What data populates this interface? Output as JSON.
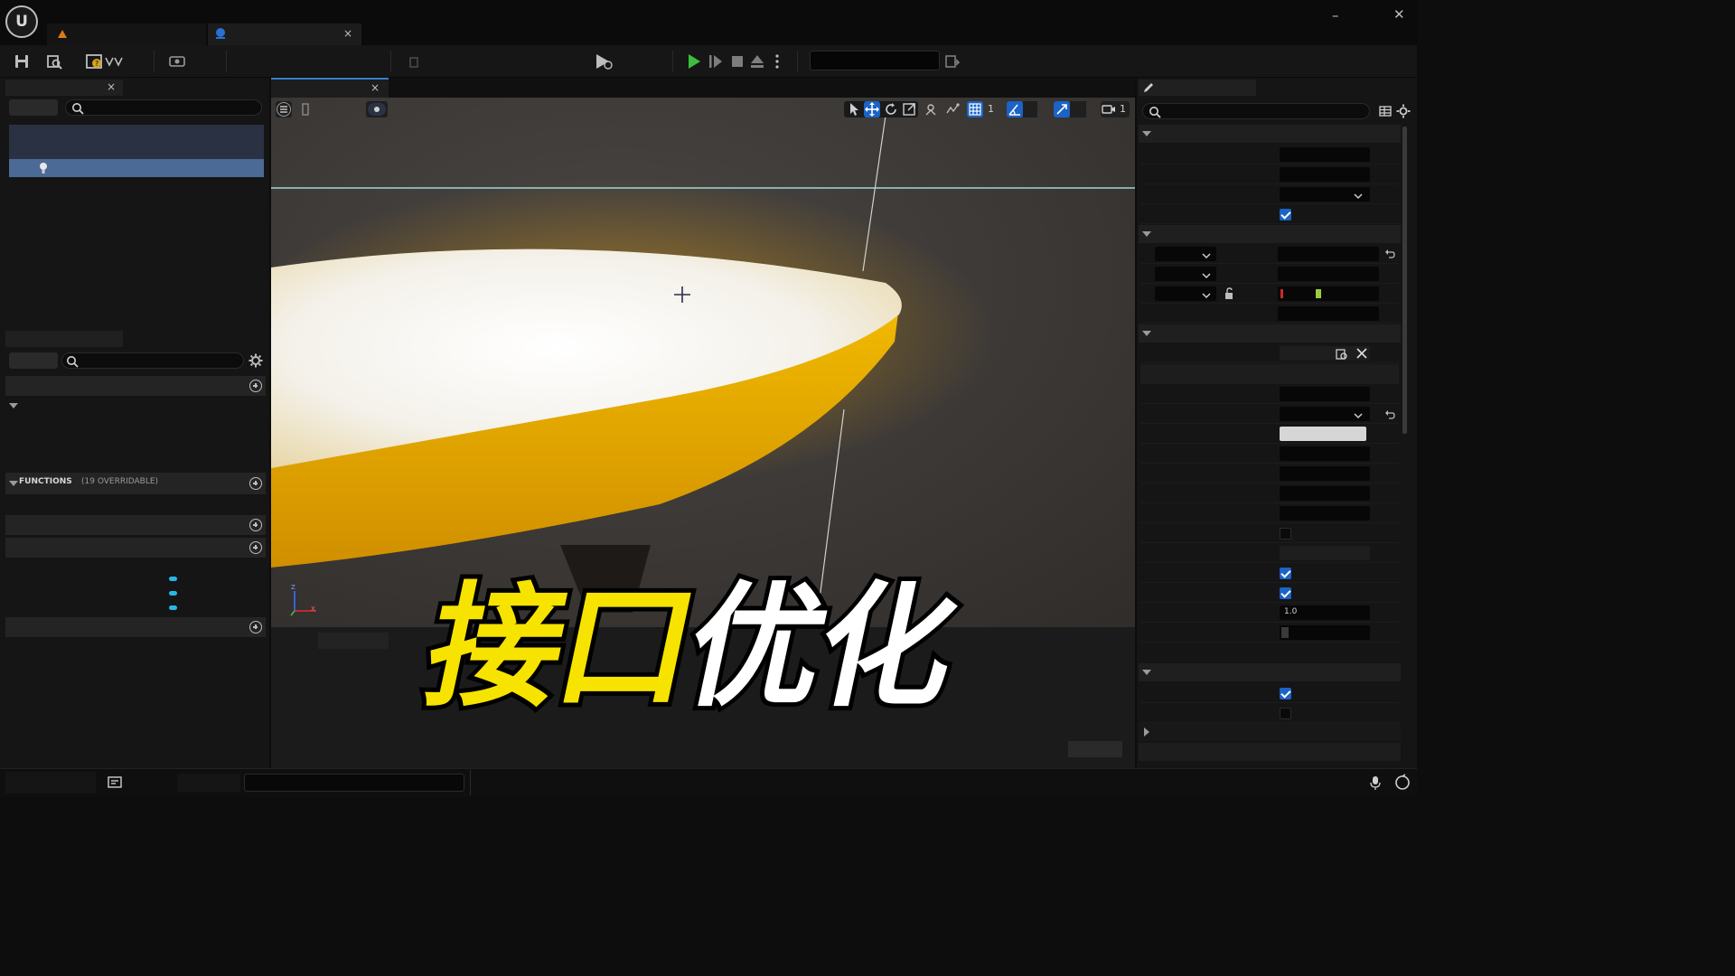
{
  "app": {
    "logo_text": "U",
    "tabs": [
      {
        "label": "",
        "icon": "blueprint-warning-icon"
      },
      {
        "label": "",
        "icon": "blueprint-actor-icon",
        "close": "×"
      }
    ],
    "window_controls": {
      "minimize": "–",
      "close": "✕"
    }
  },
  "toolbar": {
    "icons": [
      "save-icon",
      "browse-icon",
      "compile-icon",
      "diff-icon",
      "simulate-icon",
      "play-icon",
      "advance-frame-icon",
      "stop-icon",
      "eject-icon",
      "more-options-icon",
      "platform-icon"
    ],
    "platform_value": ""
  },
  "components_panel": {
    "tab_close": "×",
    "search_placeholder": "",
    "selected_item_icon": "lightbulb-icon"
  },
  "my_blueprint_panel": {
    "search_placeholder": "",
    "functions_header": "FUNCTIONS",
    "functions_count": "(19 OVERRIDABLE)"
  },
  "viewport": {
    "tab_close": "×",
    "toolbar": {
      "grid_snap_value": "1",
      "camera_speed_value": "1"
    },
    "axis_labels": {
      "z": "Z",
      "x": "X"
    }
  },
  "details": {
    "search_placeholder": "",
    "value_field": "1.0",
    "checkboxes": {
      "row_1": true,
      "row_2": true,
      "row_3": true,
      "row_4": true,
      "row_5": false,
      "row_6": false
    }
  },
  "caption": {
    "part1": "接口",
    "part2": "优化"
  },
  "colors": {
    "accent_blue": "#1b63c6",
    "play_green": "#3fbd3f",
    "caption_yellow": "#f7e300",
    "dish_yellow": "#f2b400"
  }
}
